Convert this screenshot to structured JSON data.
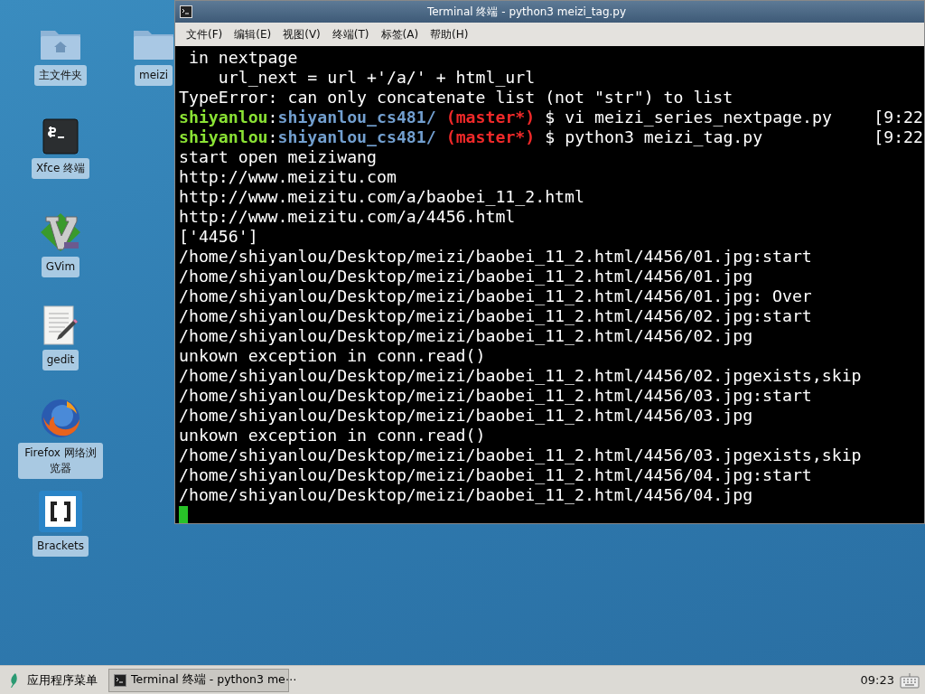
{
  "desktop_icons": [
    {
      "kind": "home-folder",
      "label": "主文件夹"
    },
    {
      "kind": "folder",
      "label": "meizi"
    },
    {
      "kind": "terminal",
      "label": "Xfce 终端"
    },
    {
      "kind": "vim",
      "label": "GVim"
    },
    {
      "kind": "editor",
      "label": "gedit"
    },
    {
      "kind": "browser",
      "label": "Firefox 网络浏览器"
    },
    {
      "kind": "brackets",
      "label": "Brackets"
    }
  ],
  "window": {
    "title": "Terminal 终端 - python3 meizi_tag.py",
    "menu": [
      "文件(F)",
      "编辑(E)",
      "视图(V)",
      "终端(T)",
      "标签(A)",
      "帮助(H)"
    ],
    "lines": [
      {
        "kind": "text",
        "text": " in nextpage"
      },
      {
        "kind": "text",
        "text": "    url_next = url +'/a/' + html_url"
      },
      {
        "kind": "text",
        "text": "TypeError: can only concatenate list (not \"str\") to list"
      },
      {
        "kind": "prompt",
        "user": "shiyanlou",
        "separator": ":",
        "path": "shiyanlou_cs481/",
        "branch": "(master*)",
        "command": "$ vi meizi_series_nextpage.py",
        "time": "[9:22"
      },
      {
        "kind": "prompt",
        "user": "shiyanlou",
        "separator": ":",
        "path": "shiyanlou_cs481/",
        "branch": "(master*)",
        "command": "$ python3 meizi_tag.py",
        "time": "[9:22"
      },
      {
        "kind": "text",
        "text": "start open meiziwang"
      },
      {
        "kind": "text",
        "text": "http://www.meizitu.com"
      },
      {
        "kind": "text",
        "text": "http://www.meizitu.com/a/baobei_11_2.html"
      },
      {
        "kind": "text",
        "text": "http://www.meizitu.com/a/4456.html"
      },
      {
        "kind": "text",
        "text": "['4456']"
      },
      {
        "kind": "text",
        "text": "/home/shiyanlou/Desktop/meizi/baobei_11_2.html/4456/01.jpg:start"
      },
      {
        "kind": "text",
        "text": "/home/shiyanlou/Desktop/meizi/baobei_11_2.html/4456/01.jpg"
      },
      {
        "kind": "text",
        "text": "/home/shiyanlou/Desktop/meizi/baobei_11_2.html/4456/01.jpg: Over"
      },
      {
        "kind": "text",
        "text": "/home/shiyanlou/Desktop/meizi/baobei_11_2.html/4456/02.jpg:start"
      },
      {
        "kind": "text",
        "text": "/home/shiyanlou/Desktop/meizi/baobei_11_2.html/4456/02.jpg"
      },
      {
        "kind": "text",
        "text": "unkown exception in conn.read()"
      },
      {
        "kind": "text",
        "text": "/home/shiyanlou/Desktop/meizi/baobei_11_2.html/4456/02.jpgexists,skip"
      },
      {
        "kind": "text",
        "text": "/home/shiyanlou/Desktop/meizi/baobei_11_2.html/4456/03.jpg:start"
      },
      {
        "kind": "text",
        "text": "/home/shiyanlou/Desktop/meizi/baobei_11_2.html/4456/03.jpg"
      },
      {
        "kind": "text",
        "text": "unkown exception in conn.read()"
      },
      {
        "kind": "text",
        "text": "/home/shiyanlou/Desktop/meizi/baobei_11_2.html/4456/03.jpgexists,skip"
      },
      {
        "kind": "text",
        "text": "/home/shiyanlou/Desktop/meizi/baobei_11_2.html/4456/04.jpg:start"
      },
      {
        "kind": "text",
        "text": "/home/shiyanlou/Desktop/meizi/baobei_11_2.html/4456/04.jpg"
      },
      {
        "kind": "cursor"
      }
    ]
  },
  "taskbar": {
    "menu_button": "应用程序菜单",
    "tasks": [
      {
        "label": "Terminal 终端 - python3 me⋯",
        "selected": true
      }
    ],
    "clock": "09:23"
  }
}
